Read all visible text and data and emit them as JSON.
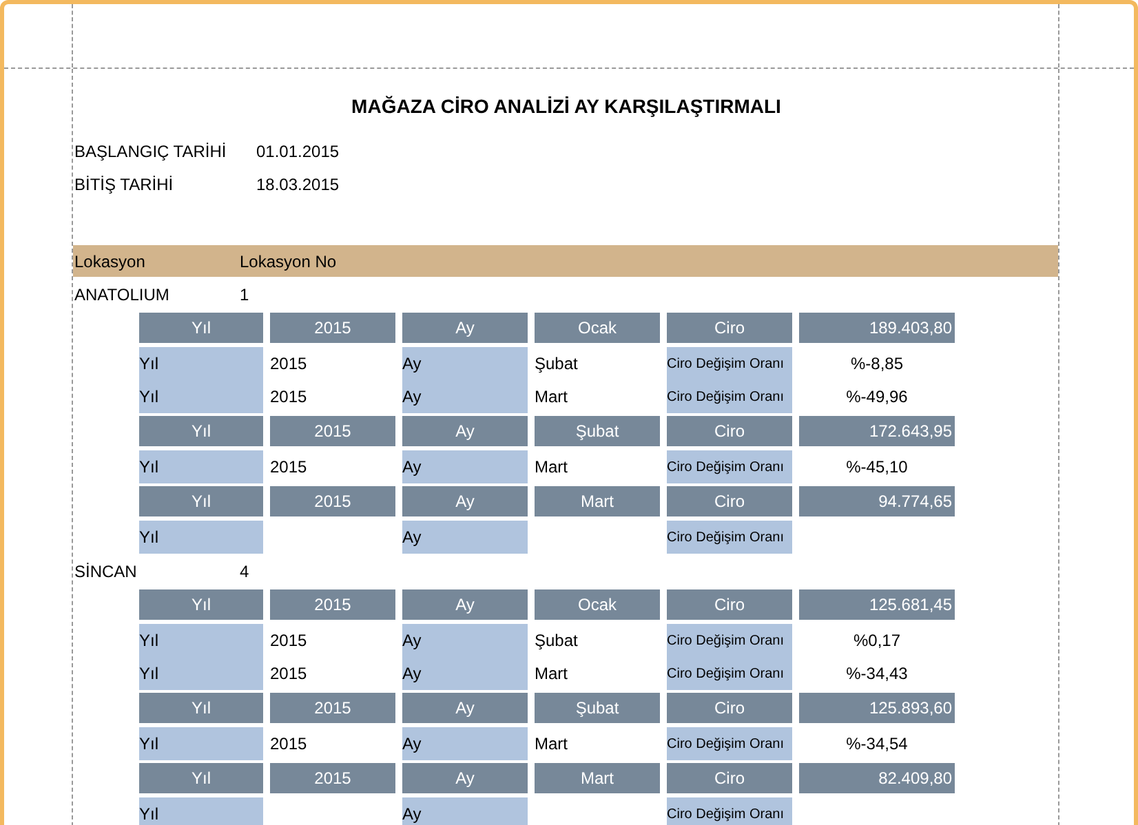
{
  "title": "MAĞAZA CİRO ANALİZİ AY KARŞILAŞTIRMALI",
  "filters": [
    {
      "label": "BAŞLANGIÇ TARİHİ",
      "value": "01.01.2015"
    },
    {
      "label": "BİTİŞ TARİHİ",
      "value": "18.03.2015"
    }
  ],
  "columns": [
    "Lokasyon",
    "Lokasyon No"
  ],
  "locations": [
    {
      "name": "ANATOLIUM",
      "number": "1",
      "rows": [
        {
          "kind": "header",
          "year_label": "Yıl",
          "year": "2015",
          "month_label": "Ay",
          "month": "Ocak",
          "measure": "Ciro",
          "value": "189.403,80"
        },
        {
          "kind": "detail",
          "year_label": "Yıl",
          "year": "2015",
          "month_label": "Ay",
          "month": "Şubat",
          "measure": "Ciro Değişim Oranı",
          "value": "%-8,85"
        },
        {
          "kind": "detail",
          "year_label": "Yıl",
          "year": "2015",
          "month_label": "Ay",
          "month": "Mart",
          "measure": "Ciro Değişim Oranı",
          "value": "%-49,96"
        },
        {
          "kind": "header",
          "year_label": "Yıl",
          "year": "2015",
          "month_label": "Ay",
          "month": "Şubat",
          "measure": "Ciro",
          "value": "172.643,95"
        },
        {
          "kind": "detail",
          "year_label": "Yıl",
          "year": "2015",
          "month_label": "Ay",
          "month": "Mart",
          "measure": "Ciro Değişim Oranı",
          "value": "%-45,10"
        },
        {
          "kind": "header",
          "year_label": "Yıl",
          "year": "2015",
          "month_label": "Ay",
          "month": "Mart",
          "measure": "Ciro",
          "value": "94.774,65"
        },
        {
          "kind": "detail",
          "year_label": "Yıl",
          "month_label": "Ay",
          "measure": "Ciro Değişim Oranı"
        }
      ]
    },
    {
      "name": "SİNCAN",
      "number": "4",
      "rows": [
        {
          "kind": "header",
          "year_label": "Yıl",
          "year": "2015",
          "month_label": "Ay",
          "month": "Ocak",
          "measure": "Ciro",
          "value": "125.681,45"
        },
        {
          "kind": "detail",
          "year_label": "Yıl",
          "year": "2015",
          "month_label": "Ay",
          "month": "Şubat",
          "measure": "Ciro Değişim Oranı",
          "value": "%0,17"
        },
        {
          "kind": "detail",
          "year_label": "Yıl",
          "year": "2015",
          "month_label": "Ay",
          "month": "Mart",
          "measure": "Ciro Değişim Oranı",
          "value": "%-34,43"
        },
        {
          "kind": "header",
          "year_label": "Yıl",
          "year": "2015",
          "month_label": "Ay",
          "month": "Şubat",
          "measure": "Ciro",
          "value": "125.893,60"
        },
        {
          "kind": "detail",
          "year_label": "Yıl",
          "year": "2015",
          "month_label": "Ay",
          "month": "Mart",
          "measure": "Ciro Değişim Oranı",
          "value": "%-34,54"
        },
        {
          "kind": "header",
          "year_label": "Yıl",
          "year": "2015",
          "month_label": "Ay",
          "month": "Mart",
          "measure": "Ciro",
          "value": "82.409,80"
        },
        {
          "kind": "detail",
          "year_label": "Yıl",
          "month_label": "Ay",
          "measure": "Ciro Değişim Oranı"
        }
      ]
    }
  ]
}
